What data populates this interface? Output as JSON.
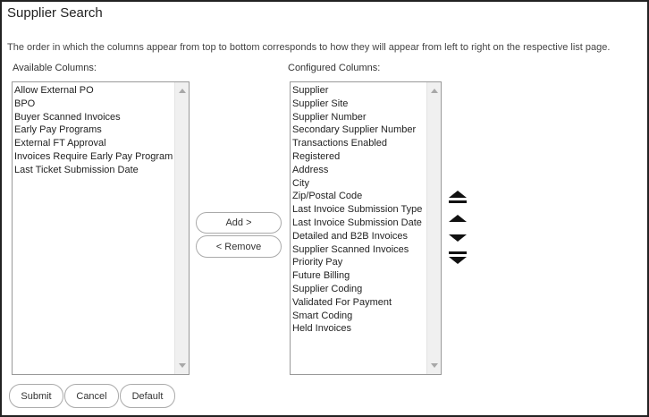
{
  "page": {
    "title": "Supplier Search",
    "description": "The order in which the columns appear from top to bottom corresponds to how they will appear from left to right on the respective list page."
  },
  "available": {
    "label": "Available Columns:",
    "items": [
      "Allow External PO",
      "BPO",
      "Buyer Scanned Invoices",
      "Early Pay Programs",
      "External FT Approval",
      "Invoices Require Early Pay Program",
      "Last Ticket Submission Date"
    ]
  },
  "configured": {
    "label": "Configured Columns:",
    "items": [
      "Supplier",
      "Supplier Site",
      "Supplier Number",
      "Secondary Supplier Number",
      "Transactions Enabled",
      "Registered",
      "Address",
      "City",
      "Zip/Postal Code",
      "Last Invoice Submission Type",
      "Last Invoice Submission Date",
      "Detailed and B2B Invoices",
      "Supplier Scanned Invoices",
      "Priority Pay",
      "Future Billing",
      "Supplier Coding",
      "Validated For Payment",
      "Smart Coding",
      "Held Invoices"
    ]
  },
  "transfer": {
    "add_label": "Add >",
    "remove_label": "< Remove"
  },
  "ordering": {
    "icons": [
      "move-to-top-icon",
      "move-up-icon",
      "move-down-icon",
      "move-to-bottom-icon"
    ]
  },
  "footer": {
    "submit_label": "Submit",
    "cancel_label": "Cancel",
    "default_label": "Default"
  }
}
